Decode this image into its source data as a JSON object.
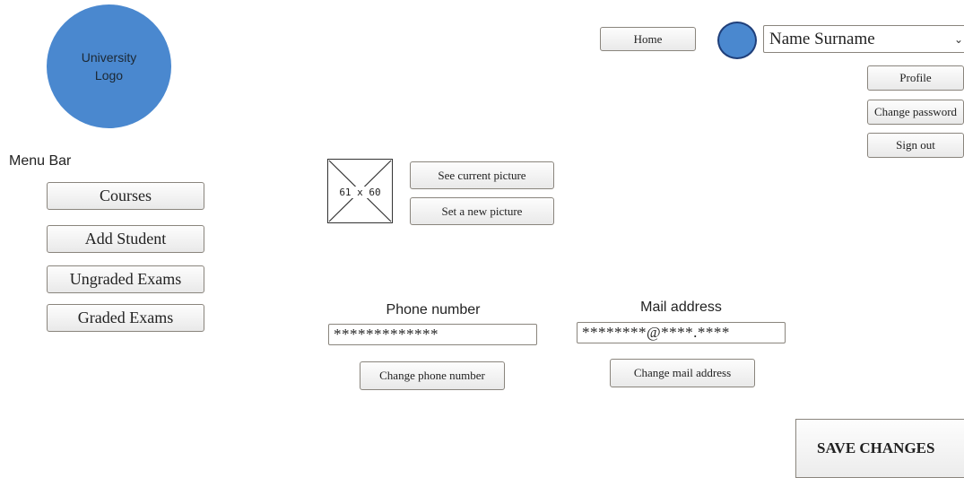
{
  "logo": {
    "line1": "University",
    "line2": "Logo"
  },
  "menu": {
    "title": "Menu Bar",
    "items": [
      {
        "label": "Courses"
      },
      {
        "label": "Add Student"
      },
      {
        "label": "Ungraded Exams"
      },
      {
        "label": "Graded Exams"
      }
    ]
  },
  "header": {
    "home_label": "Home",
    "user_name": "Name Surname",
    "user_menu": [
      "Profile",
      "Change password",
      "Sign out"
    ]
  },
  "picture": {
    "placeholder": "61 x 60",
    "see_label": "See current picture",
    "set_label": "Set a new picture"
  },
  "phone": {
    "label": "Phone number",
    "value": "*************",
    "change_label": "Change phone number"
  },
  "mail": {
    "label": "Mail address",
    "value": "********@****.****",
    "change_label": "Change mail address"
  },
  "save_label": "SAVE CHANGES",
  "colors": {
    "accent_blue": "#4a88cf",
    "avatar_border": "#1f3f7a",
    "button_border": "#8a857d"
  }
}
